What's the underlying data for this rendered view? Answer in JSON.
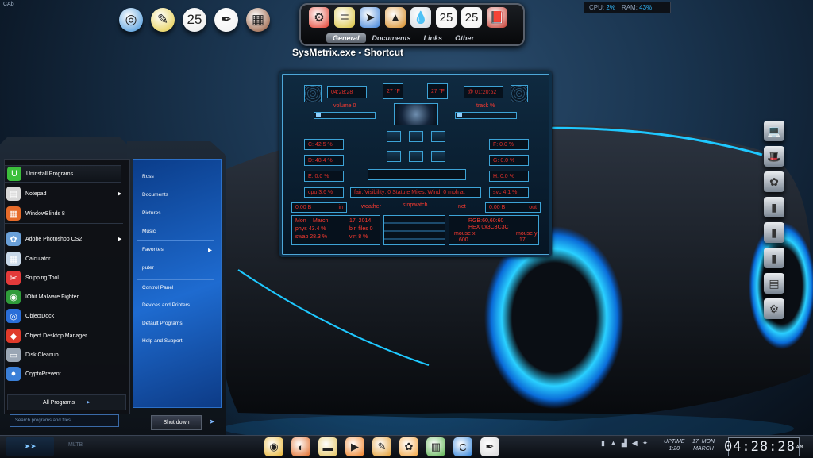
{
  "corner_label": "CAb",
  "top_left_icons": [
    {
      "icon": "earth-icon",
      "glyph": "◎",
      "color": "#3a8fd8"
    },
    {
      "icon": "crayons-icon",
      "glyph": "✎",
      "color": "#e3c93b"
    },
    {
      "icon": "calendar-icon",
      "glyph": "25",
      "color": "#e9e9e9"
    },
    {
      "icon": "quill-icon",
      "glyph": "✒",
      "color": "#f0f0f0"
    },
    {
      "icon": "cabinet-icon",
      "glyph": "▦",
      "color": "#8a4b2a"
    }
  ],
  "top_dock": {
    "icons": [
      {
        "icon": "network-icon",
        "glyph": "⚙",
        "color": "#e03a2a"
      },
      {
        "icon": "notes-icon",
        "glyph": "≣",
        "color": "#d9c23a"
      },
      {
        "icon": "cursor-icon",
        "glyph": "➤",
        "color": "#3a7fd8"
      },
      {
        "icon": "pyramid-icon",
        "glyph": "▲",
        "color": "#d78b22"
      },
      {
        "icon": "water-drop-icon",
        "glyph": "💧",
        "color": "#cfd8e0"
      },
      {
        "icon": "calendar-icon",
        "glyph": "25",
        "color": "#f0f0f0"
      },
      {
        "icon": "calendar-icon",
        "glyph": "25",
        "color": "#f0f0f0"
      },
      {
        "icon": "book-icon",
        "glyph": "📕",
        "color": "#c2352a"
      }
    ],
    "tabs": [
      "General",
      "Documents",
      "Links",
      "Other"
    ],
    "active_tab": "General"
  },
  "shortcut_label": "SysMetrix.exe - Shortcut",
  "sys_meter": {
    "cpu_label": "CPU:",
    "cpu_value": "2%",
    "ram_label": "RAM:",
    "ram_value": "43%"
  },
  "right_dock": [
    {
      "icon": "laptop-icon",
      "glyph": "💻"
    },
    {
      "icon": "hat-icon",
      "glyph": "🎩"
    },
    {
      "icon": "sunflower-icon",
      "glyph": "✿"
    },
    {
      "icon": "door-icon",
      "glyph": "▮"
    },
    {
      "icon": "door-icon",
      "glyph": "▮"
    },
    {
      "icon": "door-icon",
      "glyph": "▮"
    },
    {
      "icon": "documents-icon",
      "glyph": "▤"
    },
    {
      "icon": "network-icon",
      "glyph": "⚙"
    }
  ],
  "sysmetrix": {
    "time_left": "04:28:28",
    "temp_left": "27 °F",
    "temp_right": "27 °F",
    "time_right": "@ 01:20:52",
    "volume_label": "volume 0",
    "track_label": "track %",
    "drive_c": "C: 42.5 %",
    "drive_d": "D: 48.4 %",
    "drive_e": "E: 0.0 %",
    "drive_f": "F: 0.0 %",
    "drive_g": "G: 0.0 %",
    "drive_h": "H: 0.0 %",
    "cpu": "cpu 3.6 %",
    "weather": "fair, Visibility: 0 Statute Miles, Wind: 0 mph at",
    "svc": "svc 4.1 %",
    "net_down": "0.00 B",
    "net_down_unit": "in",
    "weather_label": "weather",
    "stopwatch_label": "stopwatch",
    "net_label": "net",
    "net_up": "0.00 B",
    "net_up_unit": "out",
    "day": "Mon",
    "month": "March",
    "date": "17, 2014",
    "phys": "phys 43.4 %",
    "bin": "bin files 0",
    "swap": "swap 28.3 %",
    "virt": "virt 8 %",
    "rgb": "RGB:60,60:60",
    "hex": "HEX 0x3C3C3C",
    "mouse_x_label": "mouse x",
    "mouse_x": "600",
    "mouse_y_label": "mouse y",
    "mouse_y": "17"
  },
  "start_menu": {
    "programs": [
      {
        "label": "Uninstall Programs",
        "icon": "uninstall-icon",
        "glyph": "U",
        "color": "#3cbf3c",
        "arrow": false
      },
      {
        "label": "Notepad",
        "icon": "notepad-icon",
        "glyph": "▤",
        "color": "#d8d8d8",
        "arrow": true
      },
      {
        "label": "WindowBlinds 8",
        "icon": "windowblinds-icon",
        "glyph": "▦",
        "color": "#e66b2a",
        "arrow": false
      },
      {
        "label": "Adobe Photoshop CS2",
        "icon": "photoshop-icon",
        "glyph": "✿",
        "color": "#6aa0d8",
        "arrow": true
      },
      {
        "label": "Calculator",
        "icon": "calculator-icon",
        "glyph": "▦",
        "color": "#c8d8e8",
        "arrow": false
      },
      {
        "label": "Snipping Tool",
        "icon": "scissors-icon",
        "glyph": "✂",
        "color": "#e33a3a",
        "arrow": false
      },
      {
        "label": "IObit Malware Fighter",
        "icon": "shield-icon",
        "glyph": "◉",
        "color": "#2f9c3a",
        "arrow": false
      },
      {
        "label": "ObjectDock",
        "icon": "objectdock-icon",
        "glyph": "◎",
        "color": "#2a6ed8",
        "arrow": false
      },
      {
        "label": "Object Desktop Manager",
        "icon": "cube-icon",
        "glyph": "◆",
        "color": "#e03a2a",
        "arrow": false
      },
      {
        "label": "Disk Cleanup",
        "icon": "disk-cleanup-icon",
        "glyph": "▭",
        "color": "#9aa6b4",
        "arrow": false
      },
      {
        "label": "CryptoPrevent",
        "icon": "lock-icon",
        "glyph": "●",
        "color": "#3a7fd8",
        "arrow": false
      }
    ],
    "all_programs": "All Programs",
    "search_placeholder": "Search programs and files",
    "places": [
      {
        "label": "Ross",
        "arrow": false
      },
      {
        "label": "Documents",
        "arrow": false
      },
      {
        "label": "Pictures",
        "arrow": false
      },
      {
        "label": "Music",
        "arrow": false
      },
      {
        "label": "Favorites",
        "arrow": true
      },
      {
        "label": "puter",
        "arrow": false
      },
      {
        "label": "Control Panel",
        "arrow": false
      },
      {
        "label": "Devices and Printers",
        "arrow": false
      },
      {
        "label": "Default Programs",
        "arrow": false
      },
      {
        "label": "Help and Support",
        "arrow": false
      }
    ],
    "shutdown": "Shut down"
  },
  "taskbar": {
    "label": "MLTB",
    "apps": [
      {
        "icon": "chrome-icon",
        "glyph": "◉",
        "color": "#e8b22a"
      },
      {
        "icon": "firefox-icon",
        "glyph": "◐",
        "color": "#e0651f"
      },
      {
        "icon": "folder-icon",
        "glyph": "▬",
        "color": "#e3c25a"
      },
      {
        "icon": "media-player-icon",
        "glyph": "▶",
        "color": "#ef7a1a"
      },
      {
        "icon": "notes-icon",
        "glyph": "✎",
        "color": "#e39a2a"
      },
      {
        "icon": "paint-icon",
        "glyph": "✿",
        "color": "#f2a23a"
      },
      {
        "icon": "chart-icon",
        "glyph": "▥",
        "color": "#55b04a"
      },
      {
        "icon": "ccleaner-icon",
        "glyph": "C",
        "color": "#2a7fd8"
      },
      {
        "icon": "quill-icon",
        "glyph": "✒",
        "color": "#d8d8d8"
      }
    ],
    "uptime_label": "UPTIME",
    "uptime_value": "1:20",
    "date_line1": "17, MON",
    "date_line2": "MARCH",
    "clock": "04:28:28",
    "clock_suffix": "AM"
  }
}
